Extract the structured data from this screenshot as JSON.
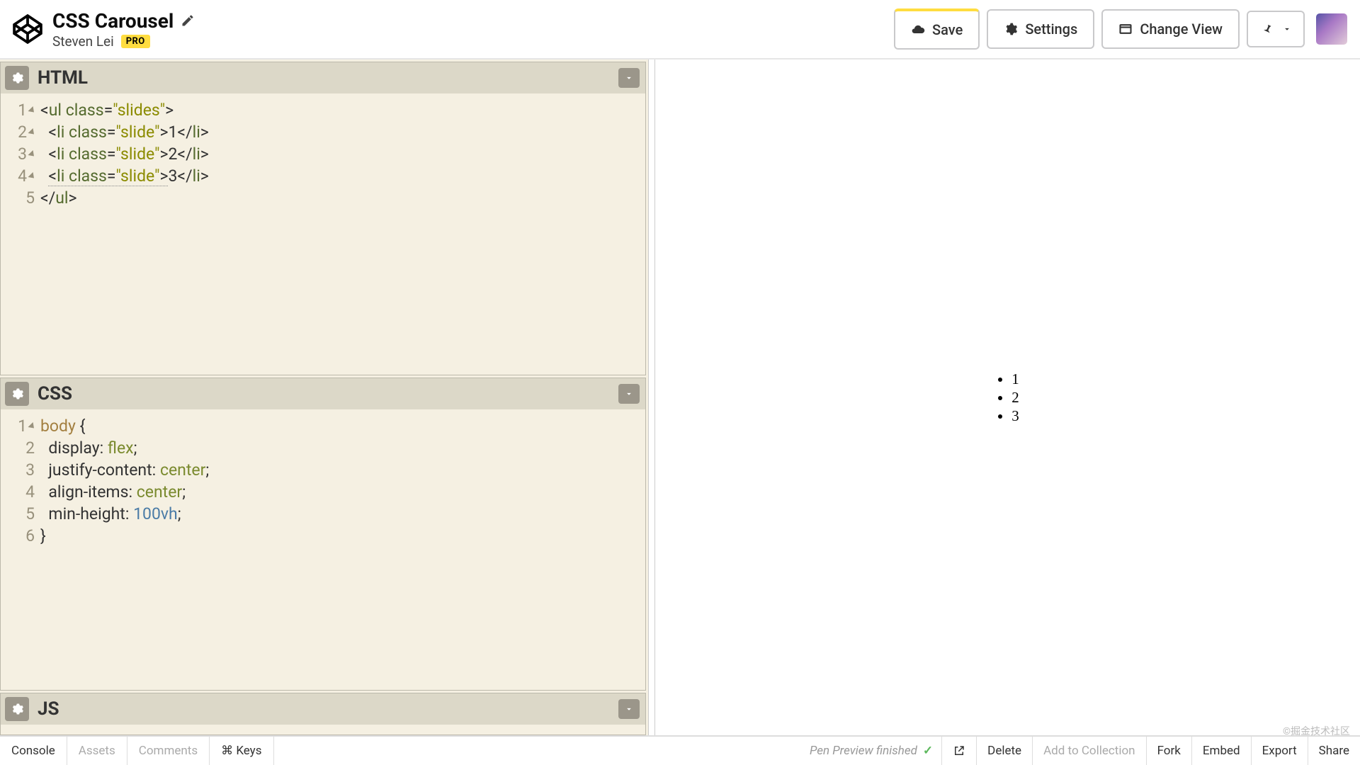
{
  "header": {
    "title": "CSS Carousel",
    "author": "Steven Lei",
    "pro_badge": "PRO",
    "buttons": {
      "save": "Save",
      "settings": "Settings",
      "change_view": "Change View"
    }
  },
  "panels": {
    "html": {
      "title": "HTML",
      "gutter": [
        "1",
        "2",
        "3",
        "4",
        "5"
      ],
      "fold": [
        true,
        true,
        true,
        true,
        false
      ],
      "code_plain": "<ul class=\"slides\">\n  <li class=\"slide\">1</li>\n  <li class=\"slide\">2</li>\n  <li class=\"slide\">3</li>\n</ul>"
    },
    "css": {
      "title": "CSS",
      "gutter": [
        "1",
        "2",
        "3",
        "4",
        "5",
        "6"
      ],
      "fold": [
        true,
        false,
        false,
        false,
        false,
        false
      ],
      "code_plain": "body {\n  display: flex;\n  justify-content: center;\n  align-items: center;\n  min-height: 100vh;\n}"
    },
    "js": {
      "title": "JS"
    }
  },
  "preview": {
    "items": [
      "1",
      "2",
      "3"
    ]
  },
  "footer": {
    "left": [
      "Console",
      "Assets",
      "Comments",
      "⌘ Keys"
    ],
    "status": "Pen Preview finished",
    "right_icon": "open-external",
    "right": [
      "Delete",
      "Add to Collection",
      "Fork",
      "Embed",
      "Export",
      "Share"
    ]
  },
  "watermark": "©掘金技术社区"
}
